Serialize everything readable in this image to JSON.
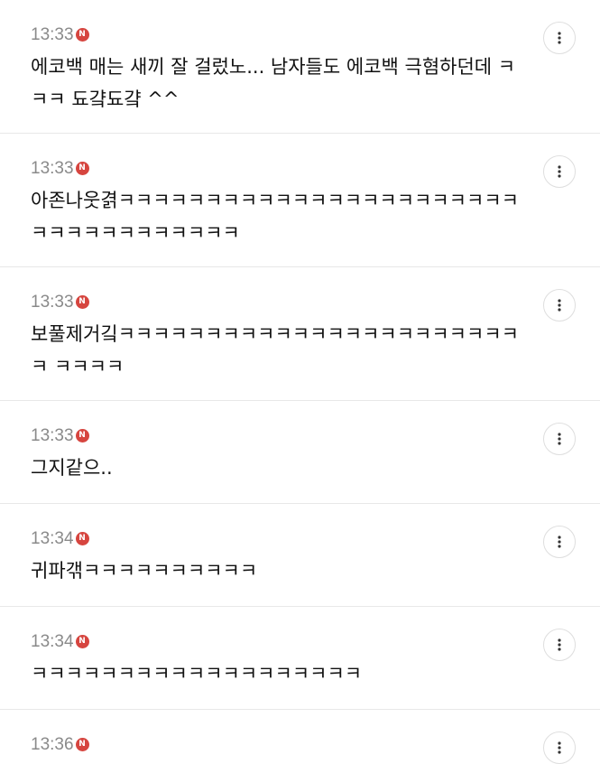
{
  "comments": [
    {
      "time": "13:33",
      "badge": "N",
      "text": "에코백 매는 새끼 잘 걸렀노... 남자들도 에코백 극혐하던데 ㅋㅋㅋ 됴걐됴걐 ^^"
    },
    {
      "time": "13:33",
      "badge": "N",
      "text": "아존나웃겱ㅋㅋㅋㅋㅋㅋㅋㅋㅋㅋㅋㅋㅋㅋㅋㅋㅋㅋㅋㅋㅋㅋㅋㅋㅋㅋㅋㅋㅋㅋㅋㅋㅋㅋㅋ"
    },
    {
      "time": "13:33",
      "badge": "N",
      "text": "보풀제거깈ㅋㅋㅋㅋㅋㅋㅋㅋㅋㅋㅋㅋㅋㅋㅋㅋㅋㅋㅋㅋㅋㅋㅋㅋ ㅋㅋㅋㅋ"
    },
    {
      "time": "13:33",
      "badge": "N",
      "text": "그지같으.."
    },
    {
      "time": "13:34",
      "badge": "N",
      "text": "귀파갞ㅋㅋㅋㅋㅋㅋㅋㅋㅋㅋ"
    },
    {
      "time": "13:34",
      "badge": "N",
      "text": "ㅋㅋㅋㅋㅋㅋㅋㅋㅋㅋㅋㅋㅋㅋㅋㅋㅋㅋㅋ"
    },
    {
      "time": "13:36",
      "badge": "N",
      "text": ""
    }
  ],
  "icons": {
    "new_badge": "new-badge-icon",
    "more": "more-vertical-icon"
  },
  "colors": {
    "badge": "#d6453f",
    "time": "#8a8a8a",
    "divider": "#e8e8e8"
  }
}
